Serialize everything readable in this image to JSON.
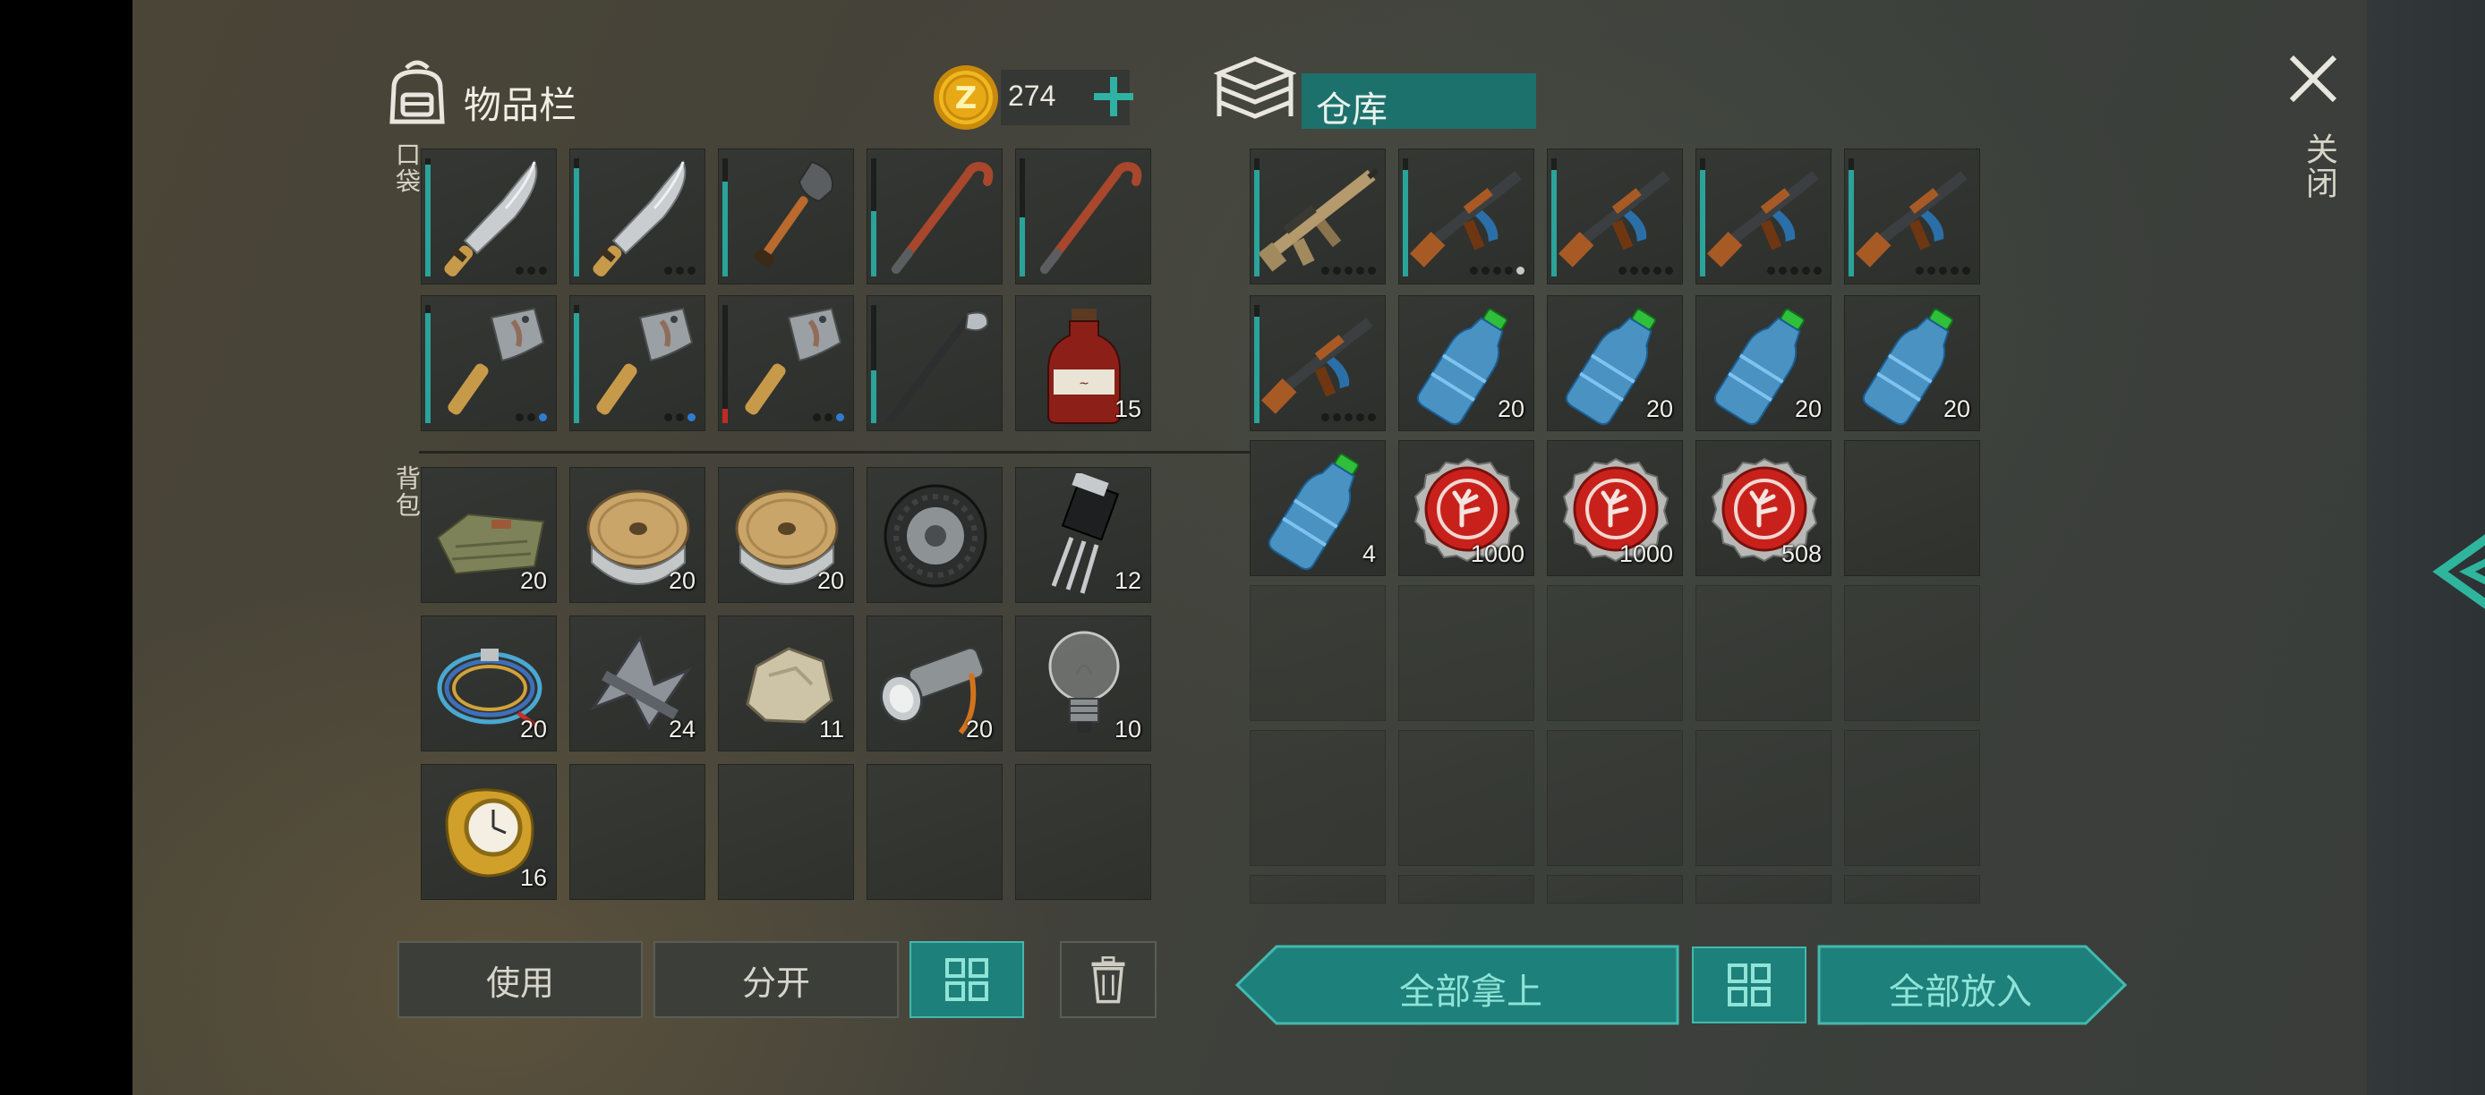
{
  "inventory": {
    "title": "物品栏",
    "coins": "274",
    "pocket_label": "口袋",
    "backpack_label": "背包",
    "pocket": [
      {
        "icon": "machete",
        "dots": [
          "k",
          "k",
          "k"
        ]
      },
      {
        "icon": "machete",
        "dots": [
          "k",
          "k",
          "k"
        ]
      },
      {
        "icon": "shovel",
        "dots": []
      },
      {
        "icon": "crowbar",
        "dots": []
      },
      {
        "icon": "crowbar",
        "dots": []
      },
      {
        "icon": "cleaver",
        "dots": [
          "k",
          "k",
          "b"
        ]
      },
      {
        "icon": "cleaver",
        "dots": [
          "k",
          "k",
          "b"
        ]
      },
      {
        "icon": "cleaver",
        "dots": [
          "k",
          "k",
          "b"
        ]
      },
      {
        "icon": "golf-club",
        "dots": []
      },
      {
        "icon": "medicine-bottle",
        "qty": "15",
        "dots": []
      }
    ],
    "backpack": [
      {
        "icon": "cloth",
        "qty": "20"
      },
      {
        "icon": "wire-spool",
        "qty": "20"
      },
      {
        "icon": "wire-spool",
        "qty": "20"
      },
      {
        "icon": "tire"
      },
      {
        "icon": "transistor",
        "qty": "12"
      },
      {
        "icon": "cable-coil",
        "qty": "20"
      },
      {
        "icon": "scrap-metal",
        "qty": "24"
      },
      {
        "icon": "stone",
        "qty": "11"
      },
      {
        "icon": "flashlight",
        "qty": "20"
      },
      {
        "icon": "light-bulb",
        "qty": "10"
      },
      {
        "icon": "gold-watch",
        "qty": "16"
      }
    ],
    "buttons": {
      "use": "使用",
      "split": "分开"
    }
  },
  "storage": {
    "title": "仓库",
    "items": [
      {
        "icon": "scar-rifle",
        "dots": [
          "k",
          "k",
          "k",
          "k",
          "k"
        ]
      },
      {
        "icon": "ak-rifle",
        "dots": [
          "k",
          "k",
          "k",
          "k",
          "w"
        ]
      },
      {
        "icon": "ak-rifle",
        "dots": [
          "k",
          "k",
          "k",
          "k",
          "k"
        ]
      },
      {
        "icon": "ak-rifle",
        "dots": [
          "k",
          "k",
          "k",
          "k",
          "k"
        ]
      },
      {
        "icon": "ak-rifle",
        "dots": [
          "k",
          "k",
          "k",
          "k",
          "k"
        ]
      },
      {
        "icon": "ak-rifle",
        "dots": [
          "k",
          "k",
          "k",
          "k",
          "k"
        ]
      },
      {
        "icon": "water-bottle",
        "qty": "20"
      },
      {
        "icon": "water-bottle",
        "qty": "20"
      },
      {
        "icon": "water-bottle",
        "qty": "20"
      },
      {
        "icon": "water-bottle",
        "qty": "20"
      },
      {
        "icon": "water-bottle",
        "qty": "4"
      },
      {
        "icon": "bottle-cap",
        "qty": "1000"
      },
      {
        "icon": "bottle-cap",
        "qty": "1000"
      },
      {
        "icon": "bottle-cap",
        "qty": "508"
      }
    ],
    "buttons": {
      "take_all": "全部拿上",
      "put_all": "全部放入"
    }
  },
  "close_label": "关闭",
  "colors": {
    "teal": "#1d807b",
    "teal_light": "#43b8ae",
    "coin": "#e1a516",
    "durability": "#2aa39a"
  }
}
